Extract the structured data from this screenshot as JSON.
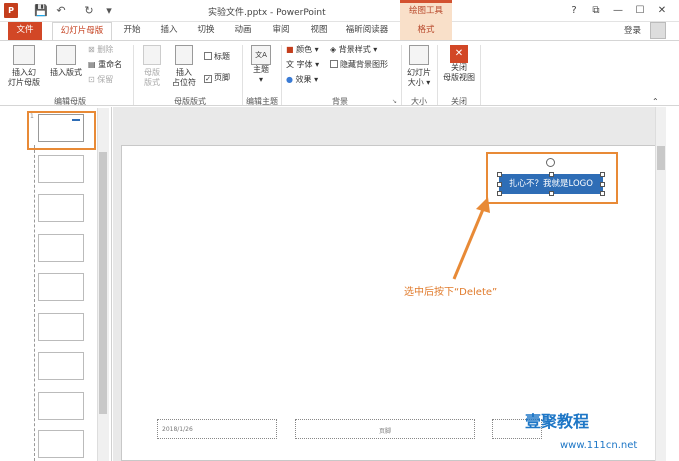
{
  "app": {
    "icon": "P",
    "title": "实验文件.pptx - PowerPoint",
    "tool_header": "绘图工具"
  },
  "quick_access": [
    "save-icon",
    "undo-icon",
    "redo-icon",
    "customize-icon"
  ],
  "window_buttons": {
    "help": "?",
    "restore": "⧉",
    "minimize": "—",
    "maximize": "☐",
    "close": "✕"
  },
  "tabs": [
    "文件",
    "幻灯片母版",
    "开始",
    "插入",
    "切换",
    "动画",
    "审阅",
    "视图",
    "福昕阅读器",
    "格式"
  ],
  "signin": "登录",
  "ribbon": {
    "insert_master": "插入幻\n灯片母版",
    "insert_layout": "插入版式",
    "delete": "删除",
    "rename": "重命名",
    "preserve": "保留",
    "master_layout": "母版\n版式",
    "insert_placeholder": "插入\n占位符",
    "title_cb": "标题",
    "footer_cb": "页脚",
    "themes": "主题",
    "colors": "颜色",
    "fonts": "字体",
    "effects": "效果",
    "bg_styles": "背景样式",
    "hide_bg": "隐藏背景图形",
    "slide_size": "幻灯片\n大小",
    "close_master": "关闭\n母版视图",
    "groups": [
      "编辑母版",
      "母版版式",
      "编辑主题",
      "背景",
      "大小",
      "关闭"
    ]
  },
  "slide": {
    "logo_text": "扎心不？我就是LOGO",
    "instruction": "选中后按下“Delete”",
    "footer_date": "2018/1/26",
    "footer_center": "页脚"
  },
  "watermark": {
    "brand": "壹聚教程",
    "url": "www.111cn.net"
  },
  "colors": {
    "accent": "#d24726",
    "highlight": "#e88a36",
    "logo_bg": "#2e6db6"
  }
}
